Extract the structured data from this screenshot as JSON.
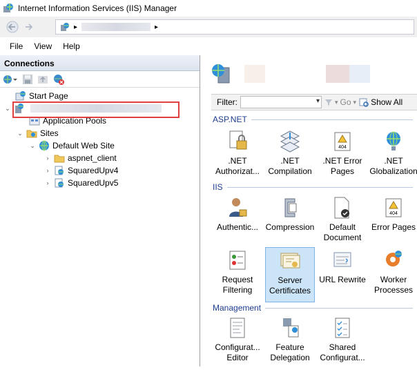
{
  "window": {
    "title": "Internet Information Services (IIS) Manager"
  },
  "address": {
    "separator": "▸"
  },
  "menu": [
    "File",
    "View",
    "Help"
  ],
  "connections": {
    "header": "Connections",
    "tree": [
      {
        "label": "Start Page"
      },
      {
        "label": ""
      },
      {
        "label": "Application Pools"
      },
      {
        "label": "Sites"
      },
      {
        "label": "Default Web Site"
      },
      {
        "label": "aspnet_client"
      },
      {
        "label": "SquaredUpv4"
      },
      {
        "label": "SquaredUpv5"
      }
    ]
  },
  "filter": {
    "label": "Filter:",
    "go": "Go",
    "show_all": "Show All"
  },
  "sections": {
    "aspnet": "ASP.NET",
    "iis": "IIS",
    "management": "Management"
  },
  "features": {
    "aspnet": [
      {
        "l1": ".NET",
        "l2": "Authorizat..."
      },
      {
        "l1": ".NET",
        "l2": "Compilation"
      },
      {
        "l1": ".NET Error",
        "l2": "Pages"
      },
      {
        "l1": ".NET",
        "l2": "Globalization"
      }
    ],
    "iis": [
      {
        "l1": "Authentic...",
        "l2": ""
      },
      {
        "l1": "Compression",
        "l2": ""
      },
      {
        "l1": "Default",
        "l2": "Document"
      },
      {
        "l1": "Error Pages",
        "l2": ""
      },
      {
        "l1": "Request",
        "l2": "Filtering"
      },
      {
        "l1": "Server",
        "l2": "Certificates"
      },
      {
        "l1": "URL Rewrite",
        "l2": ""
      },
      {
        "l1": "Worker",
        "l2": "Processes"
      }
    ],
    "management": [
      {
        "l1": "Configurat...",
        "l2": "Editor"
      },
      {
        "l1": "Feature",
        "l2": "Delegation"
      },
      {
        "l1": "Shared",
        "l2": "Configurat..."
      }
    ]
  },
  "badges": {
    "error_code": "404"
  },
  "colors": {
    "section_text": "#1e3d8f",
    "selected_bg": "#cce4f7",
    "highlight_box": "#e04040"
  }
}
